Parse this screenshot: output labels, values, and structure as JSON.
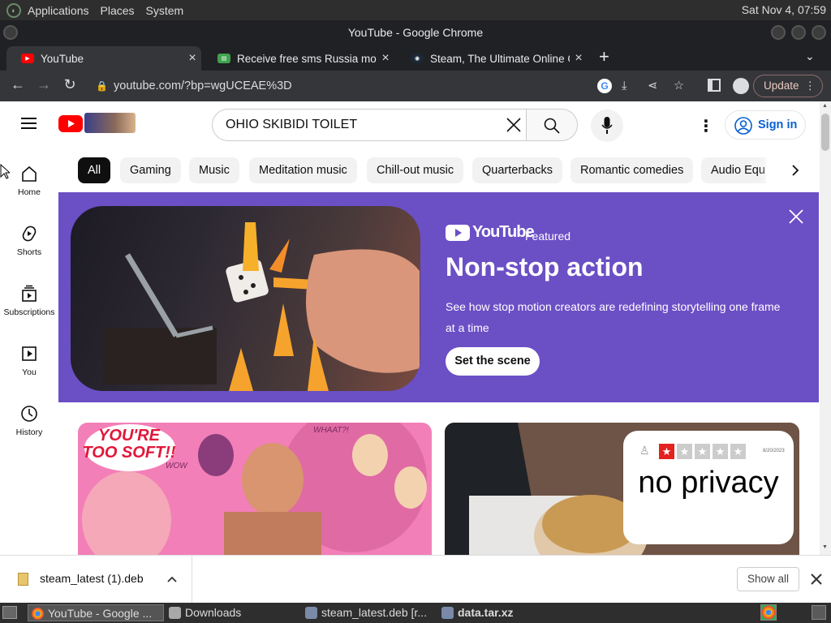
{
  "panel": {
    "menus": [
      "Applications",
      "Places",
      "System"
    ],
    "clock": "Sat Nov 4, 07:59"
  },
  "window": {
    "title": "YouTube - Google Chrome"
  },
  "tabs": [
    {
      "title": "YouTube",
      "close": "×"
    },
    {
      "title": "Receive free sms Russia mobile",
      "close": "×"
    },
    {
      "title": "Steam, The Ultimate Online Game",
      "close": "×"
    }
  ],
  "new_tab": "+",
  "toolbar": {
    "url": "youtube.com/?bp=wgUCEAE%3D",
    "update_label": "Update"
  },
  "youtube": {
    "search_value": "OHIO SKIBIDI TOILET",
    "signin_label": "Sign in",
    "chips": [
      "All",
      "Gaming",
      "Music",
      "Meditation music",
      "Chill-out music",
      "Quarterbacks",
      "Romantic comedies",
      "Audio Equ"
    ],
    "nav": [
      "Home",
      "Shorts",
      "Subscriptions",
      "You",
      "History"
    ]
  },
  "featured": {
    "logo_text": "YouTube",
    "badge": "Featured",
    "title": "Non-stop action",
    "description": "See how stop motion creators are redefining storytelling one frame at a time",
    "cta": "Set the scene"
  },
  "videos": [
    {
      "thumb_text": "YOU'RE TOO SOFT!!",
      "thumb_extra": [
        "WOW",
        "WHAAT?!"
      ]
    },
    {
      "thumb_text": "no privacy",
      "thumb_small": "8/20/2023"
    }
  ],
  "download": {
    "file": "steam_latest (1).deb",
    "show_all": "Show all"
  },
  "taskbar": {
    "tasks": [
      "YouTube - Google ...",
      "Downloads",
      "steam_latest.deb [r...",
      "data.tar.xz"
    ]
  },
  "colors": {
    "yt_red": "#ff0000",
    "banner": "#6b4fc5",
    "chrome_dark": "#202124"
  }
}
